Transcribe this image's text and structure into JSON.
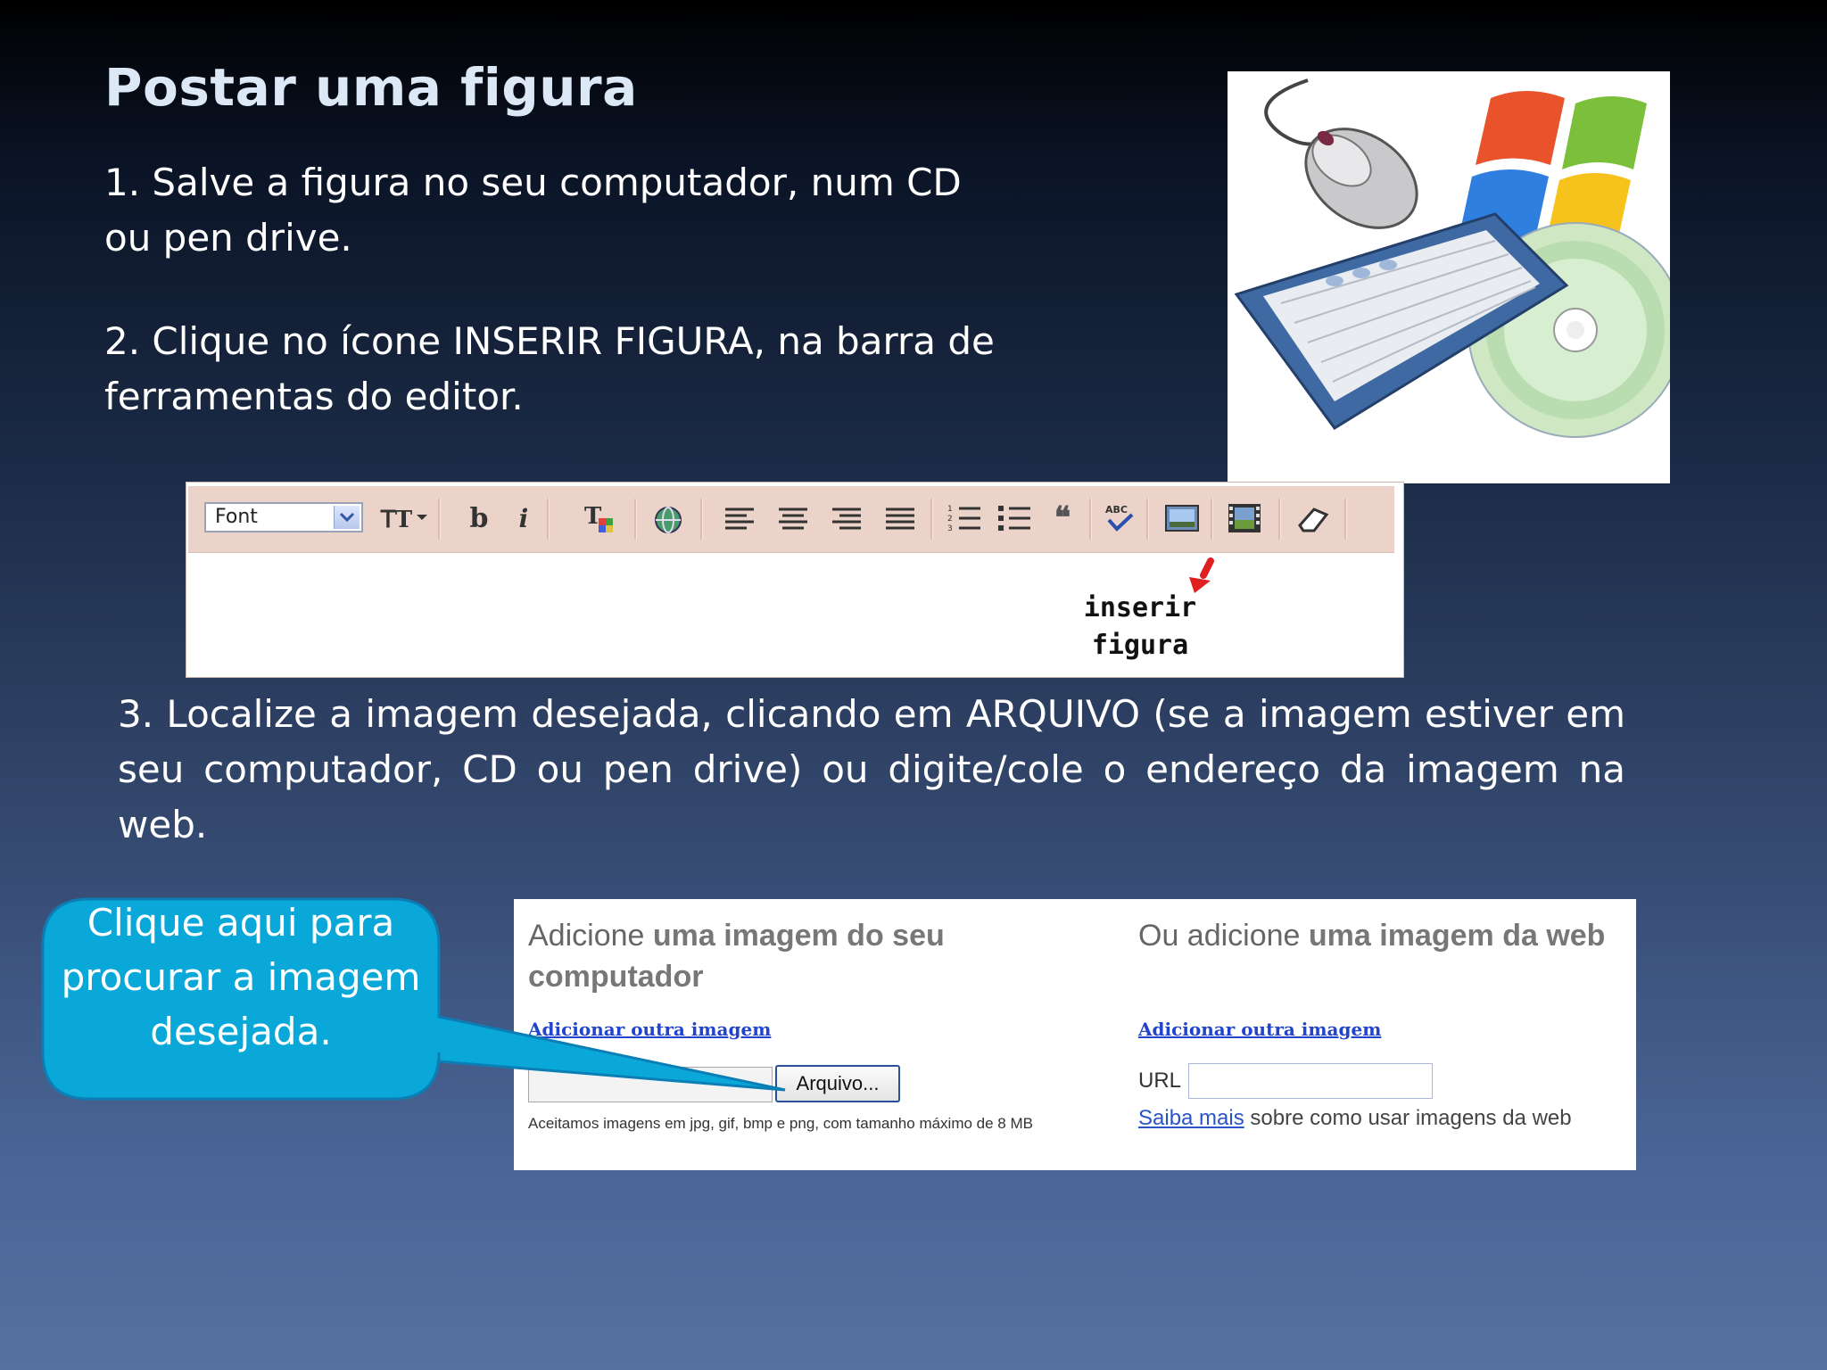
{
  "slide": {
    "title": "Postar uma figura",
    "step1": "1. Salve a figura no seu computador, num CD ou pen drive.",
    "step2": "2. Clique no ícone INSERIR FIGURA, na barra de ferramentas do editor.",
    "step3": "3. Localize a imagem desejada, clicando em ARQUIVO (se a imagem estiver em seu computador, CD ou pen drive) ou digite/cole o endereço da imagem na web."
  },
  "clipart": {
    "icons": [
      "mouse-icon",
      "windows-logo",
      "keyboard-icon",
      "cd-icon"
    ],
    "colors": {
      "red": "#e8532b",
      "green": "#7bbf3a",
      "blue": "#2f7fe0",
      "yellow": "#f6c21c"
    }
  },
  "toolbar": {
    "font_select": "Font",
    "buttons": [
      "font-size",
      "bold",
      "italic",
      "text-color",
      "link",
      "align-left",
      "align-center",
      "align-right",
      "justify",
      "numbered-list",
      "bulleted-list",
      "blockquote",
      "spellcheck",
      "insert-image",
      "insert-video",
      "remove-formatting"
    ],
    "insert_label": "inserir figura"
  },
  "callout": {
    "text": "Clique aqui para procurar a imagem desejada.",
    "fill": "#0aa8d8",
    "border": "#0b7fb5"
  },
  "upload": {
    "left_heading_plain": "Adicione ",
    "left_heading_bold": "uma imagem do seu computador",
    "left_link": "Adicionar outra imagem",
    "file_button": "Arquivo...",
    "note": "Aceitamos imagens em jpg, gif, bmp e png, com tamanho máximo de 8 MB",
    "right_heading_plain": "Ou adicione ",
    "right_heading_bold": "uma imagem da web",
    "right_link": "Adicionar outra imagem",
    "url_label": "URL",
    "learn_more_link": "Saiba mais",
    "learn_more_text": " sobre como usar imagens da web"
  }
}
